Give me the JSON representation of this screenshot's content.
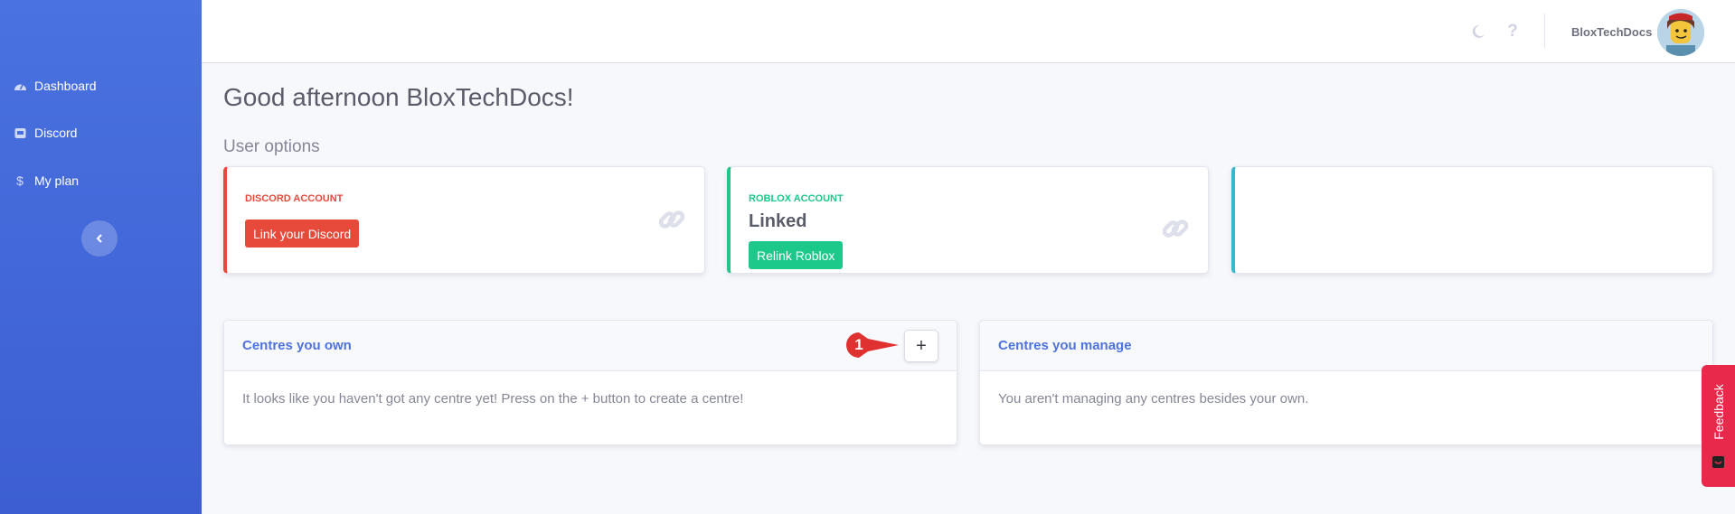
{
  "sidebar": {
    "items": [
      {
        "label": "Dashboard",
        "icon": "dashboard-icon"
      },
      {
        "label": "Discord",
        "icon": "discord-icon"
      },
      {
        "label": "My plan",
        "icon": "dollar-icon"
      }
    ],
    "collapse_icon": "chevron-left-icon"
  },
  "topbar": {
    "theme_icon": "moon-icon",
    "help_icon": "question-icon",
    "username": "BloxTechDocs"
  },
  "main": {
    "greeting": "Good afternoon BloxTechDocs!",
    "section_title": "User options",
    "accounts": [
      {
        "label": "DISCORD ACCOUNT",
        "button": "Link your Discord",
        "color": "#e74a3b"
      },
      {
        "label": "ROBLOX ACCOUNT",
        "value": "Linked",
        "button": "Relink Roblox",
        "color": "#1cc88a"
      },
      {
        "color": "#36b9cc"
      }
    ],
    "owned_panel": {
      "title": "Centres you own",
      "add_label": "+",
      "body": "It looks like you haven't got any centre yet! Press on the + button to create a centre!"
    },
    "managed_panel": {
      "title": "Centres you manage",
      "body": "You aren't managing any centres besides your own."
    }
  },
  "annotation": {
    "number": "1",
    "color": "#e03131"
  },
  "feedback": {
    "label": "Feedback"
  }
}
